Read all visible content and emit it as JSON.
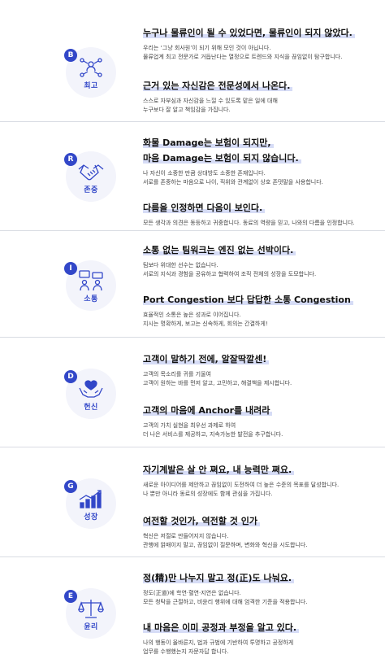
{
  "colors": {
    "accent": "#3247c8",
    "highlight": "#d6dcf6"
  },
  "sections": [
    {
      "letter": "B",
      "label": "최고",
      "icon": "network-people-icon",
      "h1": "누구나 물류인이 될 수 있었다면, 물류인이 되지 않았다.",
      "p1": [
        "우리는 ‘그냥 회사원’이 되기 위해 모인 것이 아닙니다.",
        "물류업계 최고 전문가로 거듭난다는 열정으로 트렌드와 지식을 끊임없이 탐구합니다."
      ],
      "h2": [
        "근거 있는 자신감은 전문성에서 나온다."
      ],
      "p2": [
        "스스로 자부심과 자신감을 느낄 수 있도록 맡은 일에 대해",
        "누구보다 잘 알고 책임감을 가집니다."
      ]
    },
    {
      "letter": "R",
      "label": "존중",
      "icon": "handshake-icon",
      "h1": [
        "화물 Damage는 보험이 되지만,",
        "마음 Damage는 보험이 되지 않습니다."
      ],
      "p1": [
        "나 자신이 소중한 만큼 상대방도 소중한 존재입니다.",
        "서로를 존중하는 마음으로 나이, 직위와 관계없이 상호 존댓말을 사용합니다."
      ],
      "h2": [
        "다름을 인정하면 다음이 보인다."
      ],
      "p2": [
        "모든 생각과 의견은 동등하고 귀중합니다. 동료의 역량을 믿고, 나와의 다름을 인정합니다."
      ]
    },
    {
      "letter": "I",
      "label": "소통",
      "icon": "chat-people-icon",
      "h1": "소통 없는 팀워크는 엔진 없는 선박이다.",
      "p1": [
        "팀보다 위대한 선수는 없습니다.",
        "서로의 지식과 경험을 공유하고 협력하여 조직 전체의 성장을 도모합니다."
      ],
      "h2": [
        "Port Congestion 보다 답답한 소통 Congestion"
      ],
      "p2": [
        "효율적인 소통은 높은 성과로 이어집니다.",
        "지시는 명확하게, 보고는 신속하게, 회의는 간결하게!"
      ]
    },
    {
      "letter": "D",
      "label": "헌신",
      "icon": "heart-hands-icon",
      "h1": "고객이 말하기 전에, 알잘딱깔센!",
      "p1": [
        "고객의 목소리를 귀를 기울여",
        "고객이 원하는 바를 먼저 알고, 고민하고, 해결책을 제시합니다."
      ],
      "h2": [
        "고객의 마음에 Anchor를 내려라"
      ],
      "p2": [
        "고객의 가치 실현을 최우선 과제로 하여",
        "더 나은 서비스를 제공하고, 지속가능한 발전을 추구합니다."
      ]
    },
    {
      "letter": "G",
      "label": "성장",
      "icon": "growth-chart-icon",
      "h1": "자기계발은 살 안 쪄요, 내 능력만 쪄요.",
      "p1": [
        "새로운 아이디어를 제안하고 끊임없이 도전하여 더 높은 수준의 목표를 달성합니다.",
        "나 뿐만 아니라 동료의 성장에도 함께 관심을 가집니다."
      ],
      "h2": [
        "여전할 것인가, 역전할 것 인가"
      ],
      "p2": [
        "혁신은 저절로 만들어지지 않습니다.",
        "관행에 얽매이지 말고, 끊임없이 질문하며, 변화와 혁신을 시도합니다."
      ]
    },
    {
      "letter": "E",
      "label": "윤리",
      "icon": "scales-icon",
      "h1": "정(精)만 나누지 말고 정(正)도 나눠요.",
      "p1": [
        "정도(正道)에 학연·혈연·지연은 없습니다.",
        "모든 청탁을 근절하고, 비윤리 행위에 대해 엄격한 기준을 적용합니다."
      ],
      "h2": [
        "내 마음은 이미 공정과 부정을 알고 있다."
      ],
      "p2": [
        "나의 행동이 올바른지, 법과 규범에 기반하여 투명하고 공정하게",
        "업무를 수행했는지 자문자답 합니다."
      ]
    }
  ]
}
